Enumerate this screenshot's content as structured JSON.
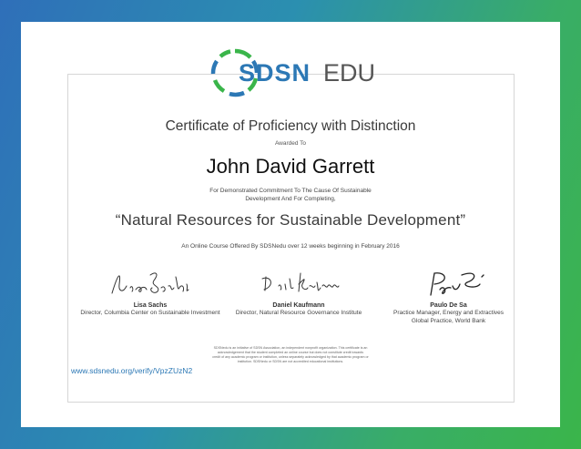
{
  "logo": {
    "sdsn": "SDSN",
    "edu": "EDU",
    "brand_blue": "#2c78b5",
    "brand_green": "#3ab54a",
    "brand_gray": "#555555"
  },
  "certificate": {
    "title": "Certificate of Proficiency with Distinction",
    "awarded_to": "Awarded To",
    "recipient": "John David Garrett",
    "demonstrated_line1": "For Demonstrated Commitment To The Cause Of Sustainable",
    "demonstrated_line2": "Development And For Completing,",
    "course": "“Natural Resources for Sustainable Development”",
    "offered": "An Online Course Offered By SDSNedu over 12 weeks beginning in February 2016"
  },
  "signatories": [
    {
      "name": "Lisa Sachs",
      "role_line1": "Director, Columbia Center on Sustainable Investment",
      "role_line2": ""
    },
    {
      "name": "Daniel Kaufmann",
      "role_line1": "Director, Natural Resource Governance Institute",
      "role_line2": ""
    },
    {
      "name": "Paulo De Sa",
      "role_line1": "Practice Manager, Energy and Extractives",
      "role_line2": "Global Practice, World Bank"
    }
  ],
  "disclaimer": {
    "line1": "SDSNedu is an initiative of SDSN Association, an independent nonprofit organization. This certificate is an",
    "line2": "acknowledgement that the student completed an online course but does not constitute credit towards",
    "line3": "credit of any academic program or institution, unless separately acknowledged by that academic program or",
    "line4": "institution. SDSNedu or SDSN are not accredited educational institutions."
  },
  "verify_link": "www.sdsnedu.org/verify/VpzZUzN2",
  "frame_colors": {
    "blue": "#2f6fb9",
    "green": "#3ab54a"
  }
}
